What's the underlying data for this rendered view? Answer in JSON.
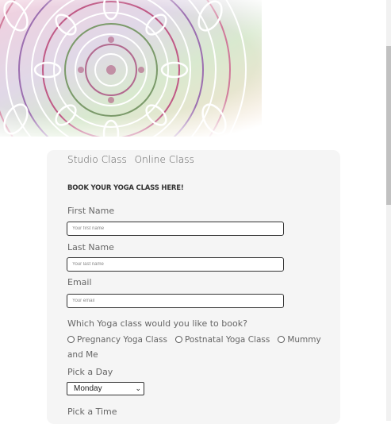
{
  "booking": {
    "tabs": [
      "Studio Class",
      "Online Class"
    ],
    "heading": "BOOK YOUR YOGA CLASS HERE!",
    "first_name": {
      "label": "First Name",
      "placeholder": "Your first name"
    },
    "last_name": {
      "label": "Last Name",
      "placeholder": "Your last name"
    },
    "email": {
      "label": "Email",
      "placeholder": "Your email"
    },
    "class_question": "Which Yoga class would you like to book?",
    "class_options": [
      "Pregnancy Yoga Class",
      "Postnatal Yoga Class",
      "Mummy and Me"
    ],
    "day_label": "Pick a Day",
    "day_value": "Monday",
    "time_label": "Pick a Time"
  },
  "icons": {
    "hero": "mandala-pattern",
    "dropdown": "chevron-down-icon"
  },
  "colors": {
    "card_bg": "#f5f5f5",
    "text": "#555555",
    "border": "#333333"
  }
}
